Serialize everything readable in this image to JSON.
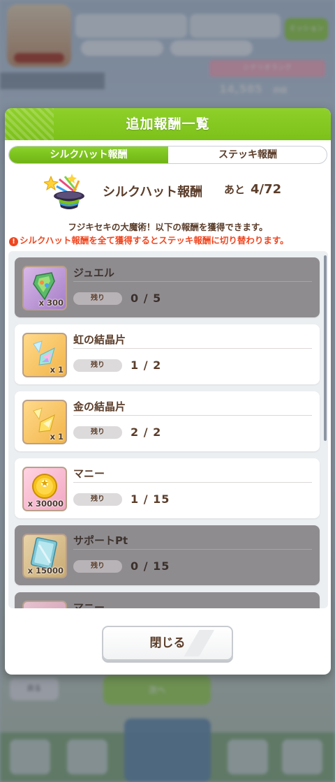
{
  "background": {
    "top_button": "ミッション",
    "ribbon": "シナリオランク",
    "score": "14,585",
    "score_action": "詳細",
    "bottom_left_button": "戻る",
    "bottom_main_button": "次へ"
  },
  "dialog": {
    "title": "追加報酬一覧",
    "tabs": [
      {
        "label": "シルクハット報酬",
        "active": true
      },
      {
        "label": "ステッキ報酬",
        "active": false
      }
    ],
    "reward_header": {
      "label": "シルクハット報酬",
      "remaining_prefix": "あと",
      "remaining_value": "4/72",
      "icon": "magic-hat-icon"
    },
    "description": "フジキセキの大魔術！以下の報酬を獲得できます。",
    "warning": "シルクハット報酬を全て獲得するとステッキ報酬に切り替わります。",
    "remain_label": "残り",
    "items": [
      {
        "name": "ジュエル",
        "qty": "x 300",
        "count": "0 / 5",
        "completed": true,
        "icon": "jewel-icon"
      },
      {
        "name": "虹の結晶片",
        "qty": "x 1",
        "count": "1 / 2",
        "completed": false,
        "icon": "rainbow-crystal-icon"
      },
      {
        "name": "金の結晶片",
        "qty": "x 1",
        "count": "2 / 2",
        "completed": false,
        "icon": "gold-crystal-icon"
      },
      {
        "name": "マニー",
        "qty": "x 30000",
        "count": "1 / 15",
        "completed": false,
        "icon": "money-coin-icon"
      },
      {
        "name": "サポートPt",
        "qty": "x 15000",
        "count": "0 / 15",
        "completed": true,
        "icon": "support-pt-card-icon"
      },
      {
        "name": "マニー",
        "qty": "",
        "count": "",
        "completed": true,
        "icon": "money-coin-icon"
      }
    ],
    "close_button": "閉じる"
  },
  "colors": {
    "header_green": "#7cc11a",
    "text_brown": "#5b3d2a",
    "warning_red": "#f0461f",
    "completed_row": "#8f8c90"
  }
}
